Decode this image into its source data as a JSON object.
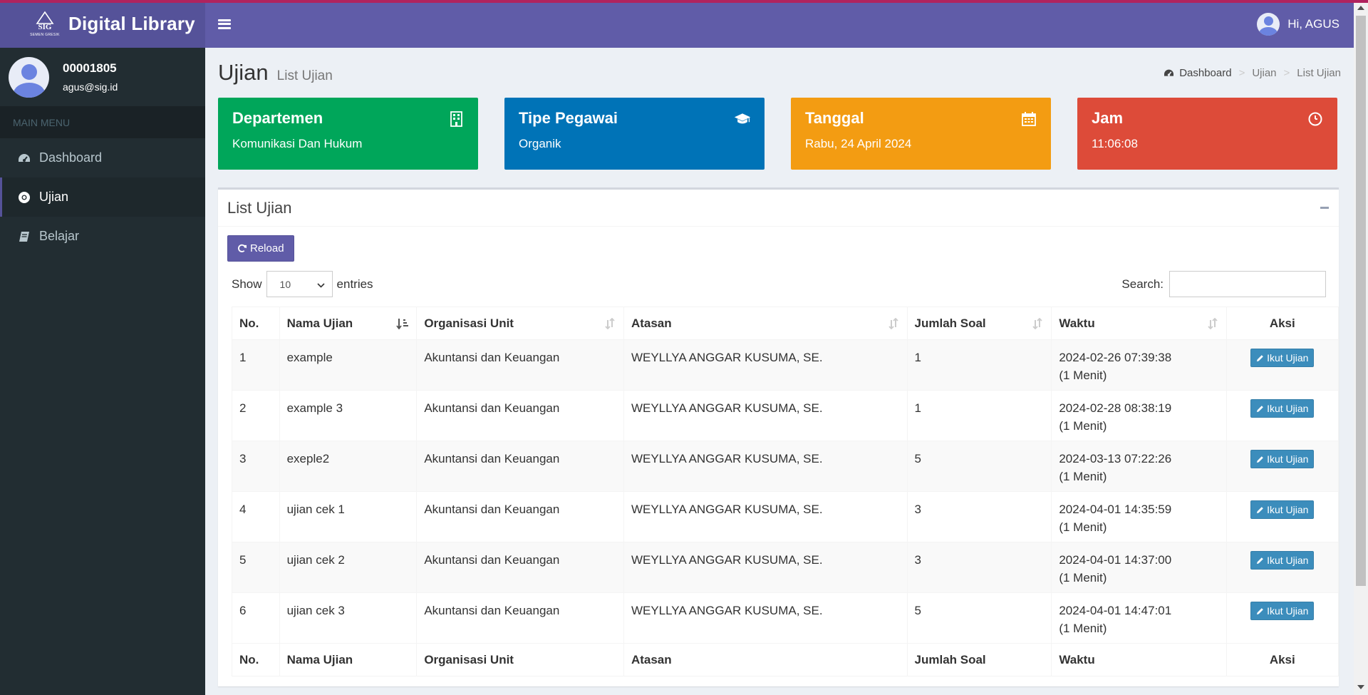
{
  "app": {
    "logo_text": "Digital Library",
    "logo_subtext": "SEMEN GRESIK",
    "logo_mark_text": "SIG"
  },
  "user": {
    "id": "00001805",
    "email": "agus@sig.id",
    "greeting": "Hi, AGUS"
  },
  "sidebar": {
    "header": "MAIN MENU",
    "items": [
      {
        "label": "Dashboard",
        "icon": "dashboard-icon"
      },
      {
        "label": "Ujian",
        "icon": "chrome-icon",
        "active": true
      },
      {
        "label": "Belajar",
        "icon": "book-icon"
      }
    ]
  },
  "page": {
    "title": "Ujian",
    "subtitle": "List Ujian",
    "breadcrumb": [
      "Dashboard",
      "Ujian",
      "List Ujian"
    ]
  },
  "info_boxes": [
    {
      "title": "Departemen",
      "value": "Komunikasi Dan Hukum",
      "color": "#00a65a",
      "icon": "building-icon"
    },
    {
      "title": "Tipe Pegawai",
      "value": "Organik",
      "color": "#0073b7",
      "icon": "graduation-cap-icon"
    },
    {
      "title": "Tanggal",
      "value": "Rabu, 24 April 2024",
      "color": "#f39c12",
      "icon": "calendar-icon"
    },
    {
      "title": "Jam",
      "value": "11:06:08",
      "color": "#dd4b39",
      "icon": "clock-icon"
    }
  ],
  "panel": {
    "title": "List Ujian",
    "reload_label": "Reload",
    "show_label": "Show",
    "entries_label": "entries",
    "entries_value": "10",
    "search_label": "Search:",
    "search_value": ""
  },
  "table": {
    "columns": [
      "No.",
      "Nama Ujian",
      "Organisasi Unit",
      "Atasan",
      "Jumlah Soal",
      "Waktu",
      "Aksi"
    ],
    "action_label": "Ikut Ujian",
    "rows": [
      {
        "no": "1",
        "nama": "example",
        "unit": "Akuntansi dan Keuangan",
        "atasan": "WEYLLYA ANGGAR KUSUMA, SE.",
        "soal": "1",
        "waktu": "2024-02-26 07:39:38",
        "durasi": "(1 Menit)"
      },
      {
        "no": "2",
        "nama": "example 3",
        "unit": "Akuntansi dan Keuangan",
        "atasan": "WEYLLYA ANGGAR KUSUMA, SE.",
        "soal": "1",
        "waktu": "2024-02-28 08:38:19",
        "durasi": "(1 Menit)"
      },
      {
        "no": "3",
        "nama": "exeple2",
        "unit": "Akuntansi dan Keuangan",
        "atasan": "WEYLLYA ANGGAR KUSUMA, SE.",
        "soal": "5",
        "waktu": "2024-03-13 07:22:26",
        "durasi": "(1 Menit)"
      },
      {
        "no": "4",
        "nama": "ujian cek 1",
        "unit": "Akuntansi dan Keuangan",
        "atasan": "WEYLLYA ANGGAR KUSUMA, SE.",
        "soal": "3",
        "waktu": "2024-04-01 14:35:59",
        "durasi": "(1 Menit)"
      },
      {
        "no": "5",
        "nama": "ujian cek 2",
        "unit": "Akuntansi dan Keuangan",
        "atasan": "WEYLLYA ANGGAR KUSUMA, SE.",
        "soal": "3",
        "waktu": "2024-04-01 14:37:00",
        "durasi": "(1 Menit)"
      },
      {
        "no": "6",
        "nama": "ujian cek 3",
        "unit": "Akuntansi dan Keuangan",
        "atasan": "WEYLLYA ANGGAR KUSUMA, SE.",
        "soal": "5",
        "waktu": "2024-04-01 14:47:01",
        "durasi": "(1 Menit)"
      }
    ]
  }
}
